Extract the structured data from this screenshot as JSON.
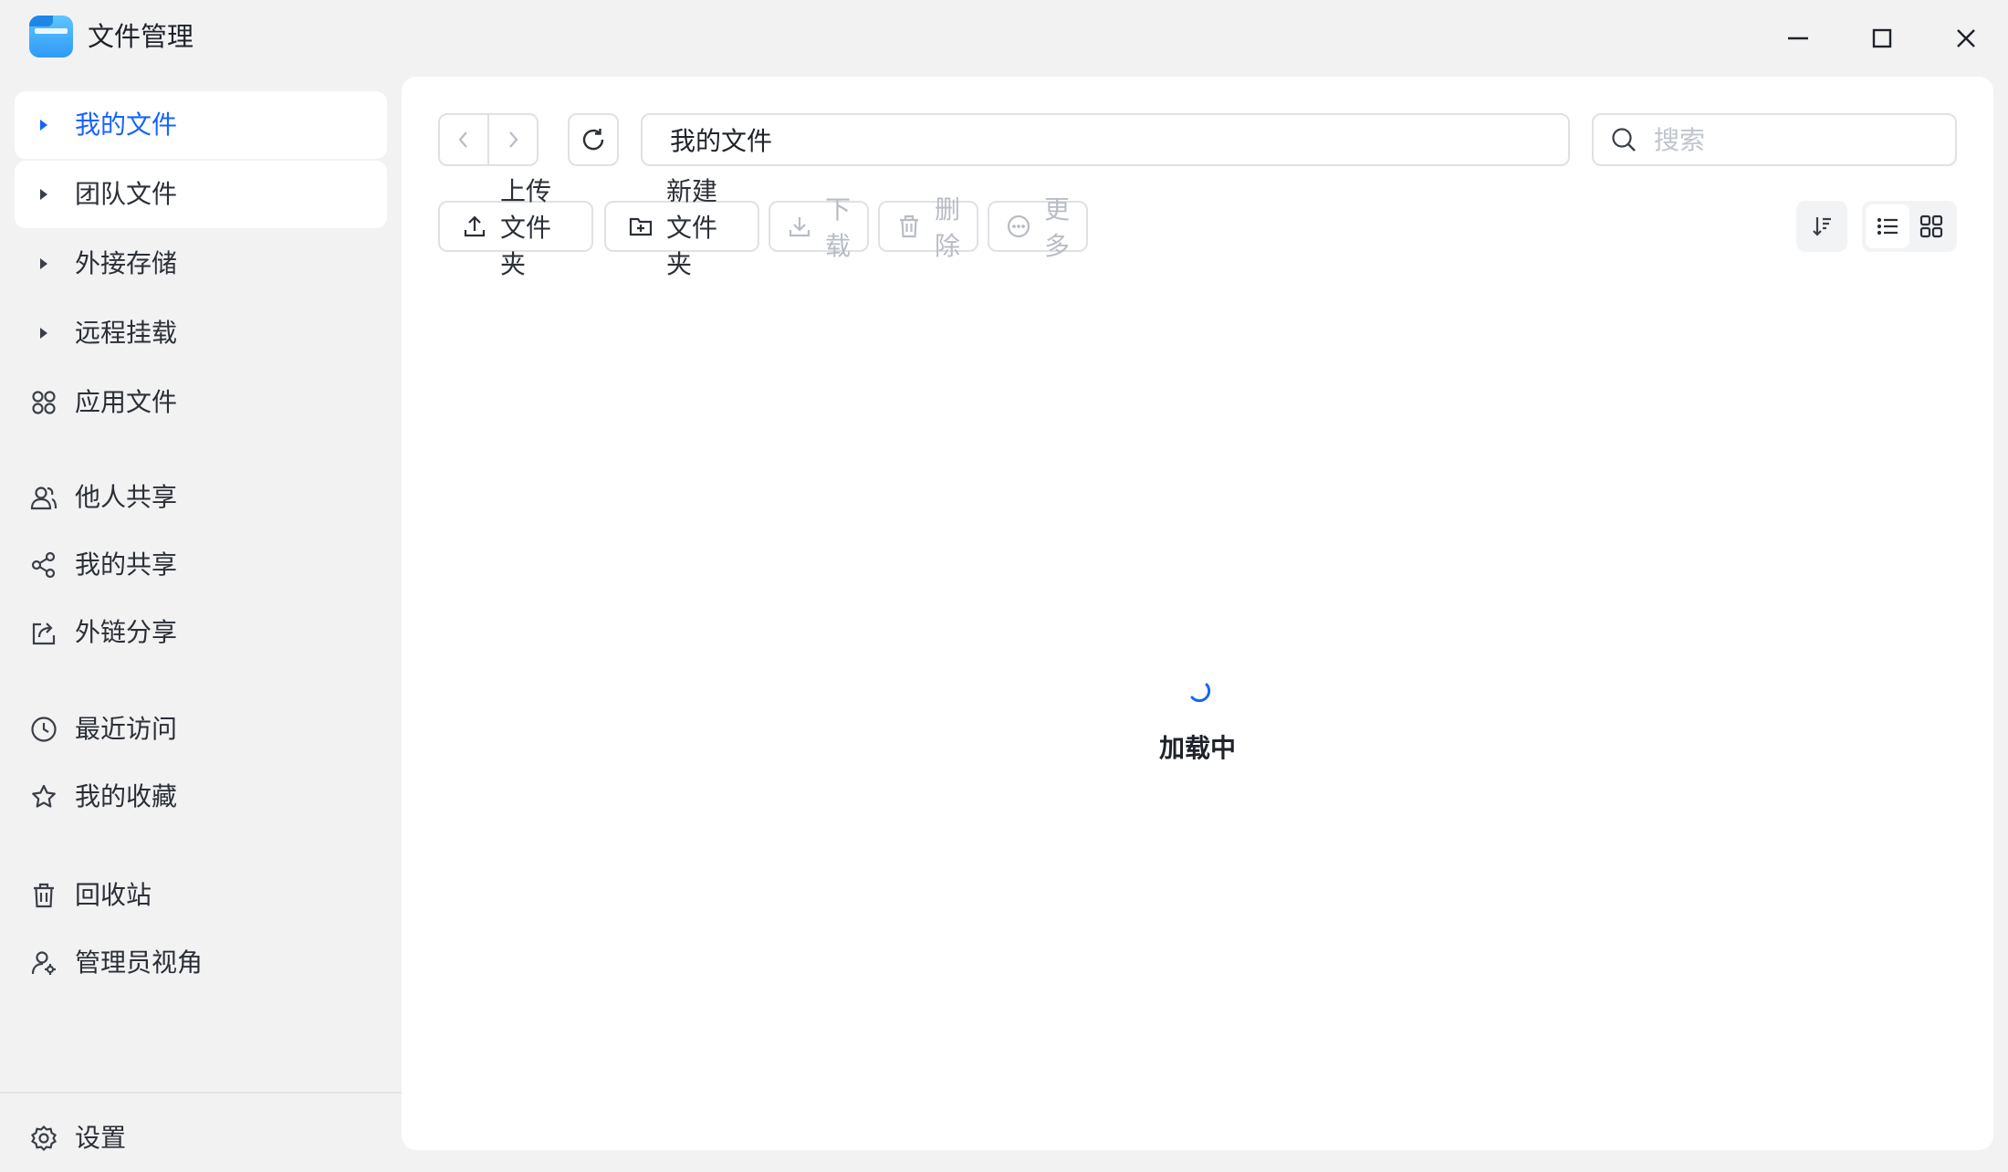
{
  "app": {
    "title": "文件管理"
  },
  "sidebar": {
    "items": [
      {
        "label": "我的文件"
      },
      {
        "label": "团队文件"
      },
      {
        "label": "外接存储"
      },
      {
        "label": "远程挂载"
      },
      {
        "label": "应用文件"
      },
      {
        "label": "他人共享"
      },
      {
        "label": "我的共享"
      },
      {
        "label": "外链分享"
      },
      {
        "label": "最近访问"
      },
      {
        "label": "我的收藏"
      },
      {
        "label": "回收站"
      },
      {
        "label": "管理员视角"
      }
    ],
    "settings_label": "设置"
  },
  "toolbar": {
    "path": "我的文件",
    "search_placeholder": "搜索",
    "upload_folder": "上传文件夹",
    "new_folder": "新建文件夹",
    "download": "下载",
    "delete": "删除",
    "more": "更多"
  },
  "content": {
    "loading_text": "加载中"
  },
  "colors": {
    "accent": "#1664ff",
    "disabled": "#b8bcc3",
    "background": "#f2f2f3"
  }
}
